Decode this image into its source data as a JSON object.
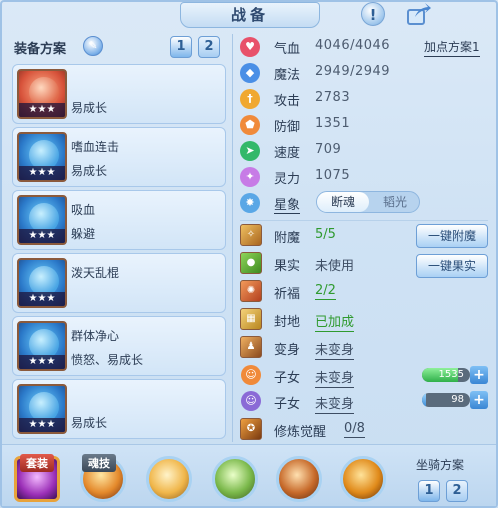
{
  "header": {
    "title": "战备",
    "help_label": "!"
  },
  "left_panel": {
    "title": "装备方案",
    "scheme_buttons": [
      "1",
      "2"
    ],
    "cards": [
      {
        "line1": "",
        "line2": "易成长",
        "stars": "★★★"
      },
      {
        "line1": "嗜血连击",
        "line2": "易成长",
        "stars": "★★★"
      },
      {
        "line1": "吸血",
        "line2": "躲避",
        "stars": "★★★"
      },
      {
        "line1": "泼天乱棍",
        "line2": "",
        "stars": "★★★"
      },
      {
        "line1": "群体净心",
        "line2": "愤怒、易成长",
        "stars": "★★★"
      },
      {
        "line1": "",
        "line2": "易成长",
        "stars": "★★★"
      }
    ]
  },
  "stats": {
    "plus_scheme": "加点方案1",
    "rows": [
      {
        "label": "气血",
        "value": "4046/4046",
        "color": "#e8516a"
      },
      {
        "label": "魔法",
        "value": "2949/2949",
        "color": "#4a8fe6"
      },
      {
        "label": "攻击",
        "value": "2783",
        "color": "#f0a830"
      },
      {
        "label": "防御",
        "value": "1351",
        "color": "#f08a3a"
      },
      {
        "label": "速度",
        "value": "709",
        "color": "#33b86a"
      },
      {
        "label": "灵力",
        "value": "1075",
        "color": "#c77be6"
      }
    ],
    "star_label": "星象",
    "star_options": [
      "断魂",
      "韬光"
    ]
  },
  "props": {
    "rows": [
      {
        "label": "附魔",
        "value": "5/5",
        "green": true
      },
      {
        "label": "果实",
        "value": "未使用",
        "green": false
      },
      {
        "label": "祈福",
        "value": "2/2",
        "green": true
      },
      {
        "label": "封地",
        "value": "已加成",
        "green": true
      },
      {
        "label": "变身",
        "value": "未变身",
        "green": false
      },
      {
        "label": "子女",
        "value": "未变身",
        "green": false
      },
      {
        "label": "子女",
        "value": "未变身",
        "green": false
      },
      {
        "label": "修炼觉醒",
        "value": "0/8",
        "green": false
      }
    ],
    "enchant_btn": "一键附魔",
    "fruit_btn": "一键果实",
    "child1_value": "1535",
    "child1_fill": 0.75,
    "child2_value": "98",
    "child2_fill": 0.08
  },
  "bottom": {
    "suit_label": "套装",
    "skill_label": "魂技",
    "mount_title": "坐骑方案",
    "mount_buttons": [
      "1",
      "2"
    ]
  }
}
